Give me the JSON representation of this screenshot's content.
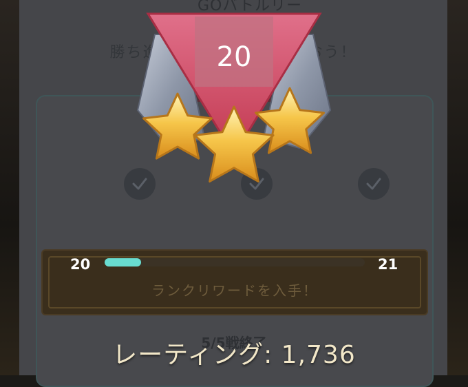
{
  "header": {
    "partial_title": "GOバトルリーグ",
    "subtitle": "勝ち進んでリワードをもらおう！"
  },
  "rank_badge": {
    "rank": "20",
    "stars": 3
  },
  "progress": {
    "current_rank": "20",
    "next_rank": "21",
    "fraction": 0.14
  },
  "reward": {
    "label": "ランクリワードを入手！"
  },
  "battle_status": {
    "text": "5/5戦終了",
    "checks": 3
  },
  "rating": {
    "text": "レーティング: 1,736"
  },
  "colors": {
    "progress_fill": "#68dcd0",
    "badge_red": "#d9475f",
    "star_gold": "#f6c64a"
  }
}
